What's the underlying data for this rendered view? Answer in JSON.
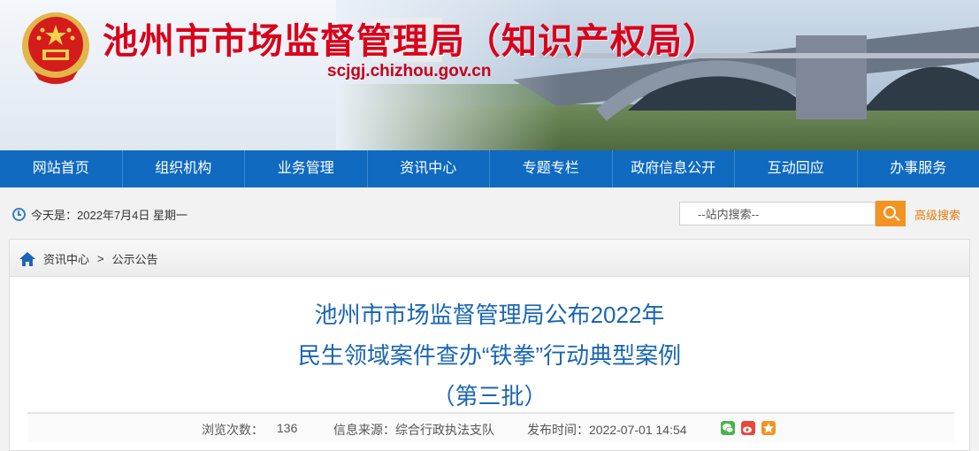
{
  "header": {
    "site_title": "池州市市场监督管理局（知识产权局）",
    "domain": "scjgj.chizhou.gov.cn",
    "emblem": "national-emblem-icon"
  },
  "nav": {
    "items": [
      "网站首页",
      "组织机构",
      "业务管理",
      "资讯中心",
      "专题专栏",
      "政府信息公开",
      "互动回应",
      "办事服务"
    ]
  },
  "infobar": {
    "date_text": "今天是：2022年7月4日 星期一",
    "search_placeholder": "--站内搜索--",
    "advanced_search": "高级搜索"
  },
  "breadcrumb": {
    "items": [
      "资讯中心",
      "公示公告"
    ],
    "separator": ">"
  },
  "article": {
    "title_line1": "池州市市场监督管理局公布2022年",
    "title_line2": "民生领域案件查办“铁拳”行动典型案例",
    "title_line3": "（第三批）",
    "views_label": "浏览次数：",
    "views": "136",
    "source": "信息来源：综合行政执法支队",
    "publish": "发布时间：2022-07-01 14:54"
  },
  "colors": {
    "nav_bg": "#0f6ac0",
    "title_red": "#d9001b",
    "article_blue": "#1a66b3",
    "accent_orange": "#f29322"
  },
  "share_icons": [
    "wechat-icon",
    "weibo-icon",
    "favorite-icon"
  ]
}
